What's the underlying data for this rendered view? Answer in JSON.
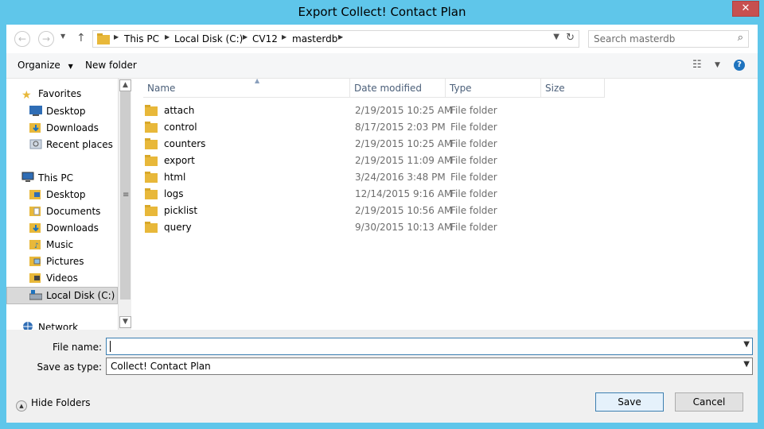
{
  "window": {
    "title": "Export Collect! Contact Plan",
    "close_label": "✕"
  },
  "address_bar": {
    "crumbs": [
      "This PC",
      "Local Disk (C:)",
      "CV12",
      "masterdb"
    ]
  },
  "search": {
    "placeholder": "Search masterdb"
  },
  "toolbar": {
    "organize_label": "Organize",
    "new_folder_label": "New folder"
  },
  "nav_pane": {
    "favorites": {
      "label": "Favorites",
      "items": [
        "Desktop",
        "Downloads",
        "Recent places"
      ]
    },
    "this_pc": {
      "label": "This PC",
      "items": [
        "Desktop",
        "Documents",
        "Downloads",
        "Music",
        "Pictures",
        "Videos",
        "Local Disk (C:)"
      ]
    },
    "network": {
      "label": "Network"
    }
  },
  "columns": {
    "name": "Name",
    "date_modified": "Date modified",
    "type": "Type",
    "size": "Size"
  },
  "files": [
    {
      "name": "attach",
      "date": "2/19/2015 10:25 AM",
      "type": "File folder"
    },
    {
      "name": "control",
      "date": "8/17/2015 2:03 PM",
      "type": "File folder"
    },
    {
      "name": "counters",
      "date": "2/19/2015 10:25 AM",
      "type": "File folder"
    },
    {
      "name": "export",
      "date": "2/19/2015 11:09 AM",
      "type": "File folder"
    },
    {
      "name": "html",
      "date": "3/24/2016 3:48 PM",
      "type": "File folder"
    },
    {
      "name": "logs",
      "date": "12/14/2015 9:16 AM",
      "type": "File folder"
    },
    {
      "name": "picklist",
      "date": "2/19/2015 10:56 AM",
      "type": "File folder"
    },
    {
      "name": "query",
      "date": "9/30/2015 10:13 AM",
      "type": "File folder"
    }
  ],
  "fields": {
    "file_name_label": "File name:",
    "file_name_value": "",
    "save_type_label": "Save as type:",
    "save_type_value": "Collect! Contact Plan"
  },
  "footer": {
    "hide_folders_label": "Hide Folders",
    "save_label": "Save",
    "cancel_label": "Cancel"
  },
  "colors": {
    "titlebar": "#5fc6ea",
    "close": "#c75050",
    "folder": "#e8b83a",
    "accent": "#3c7fb1"
  }
}
